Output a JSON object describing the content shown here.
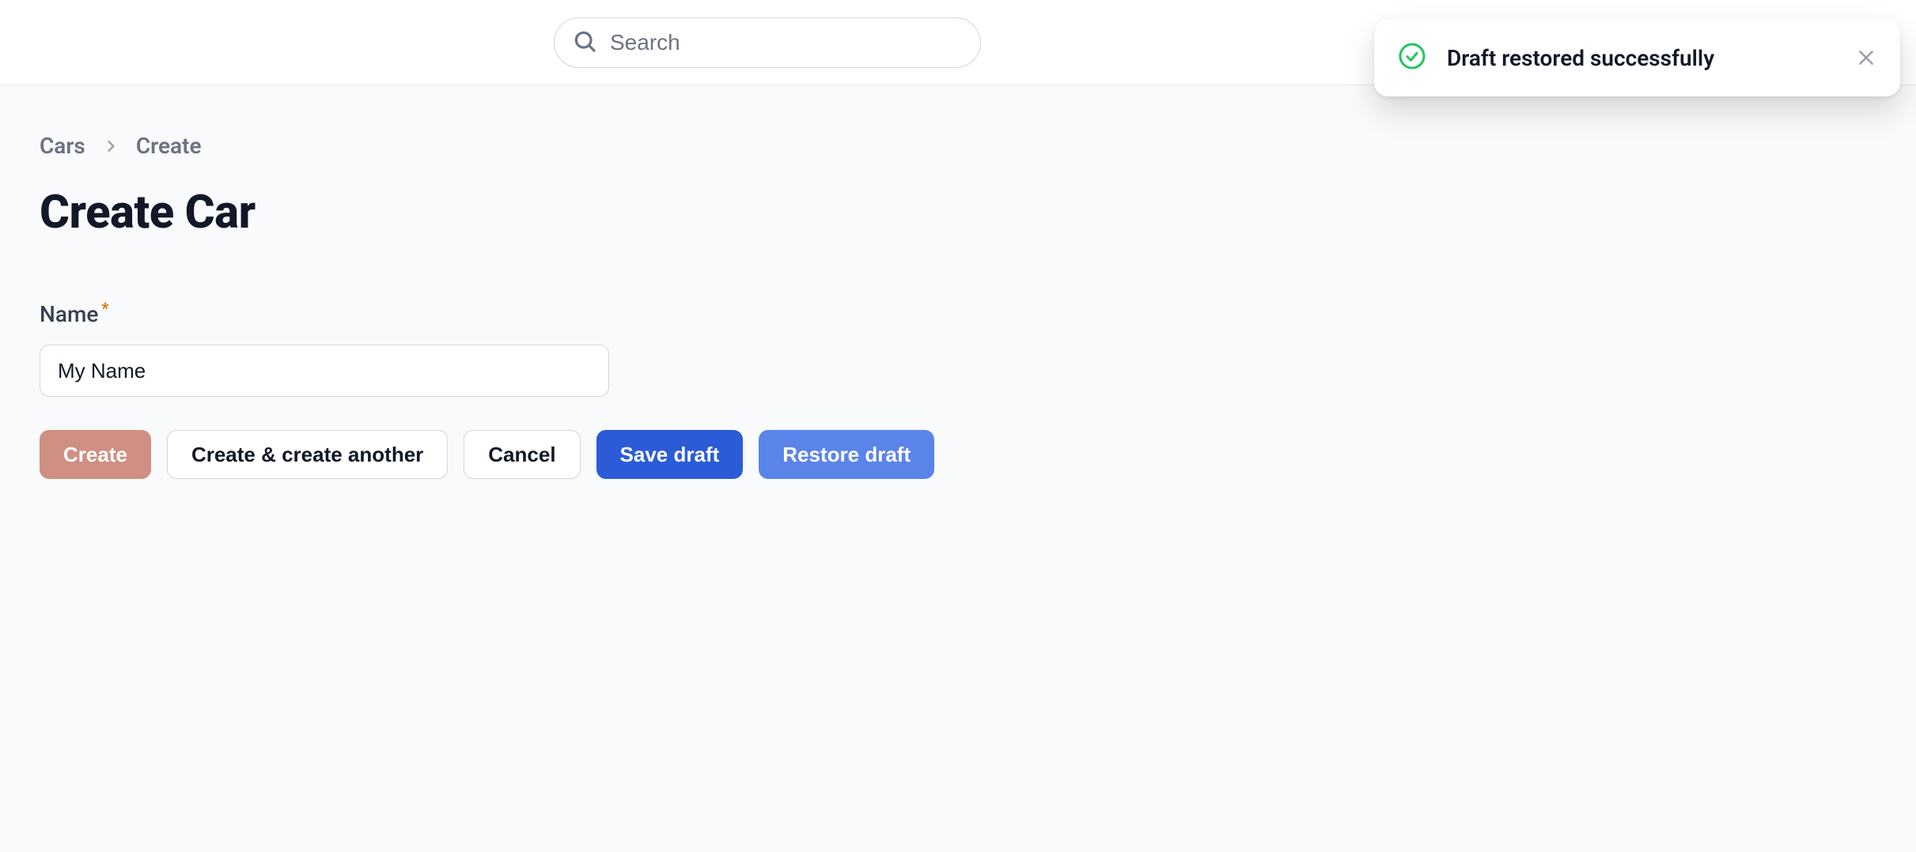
{
  "search": {
    "placeholder": "Search",
    "value": ""
  },
  "toast": {
    "message": "Draft restored successfully"
  },
  "breadcrumb": {
    "items": [
      {
        "label": "Cars"
      },
      {
        "label": "Create"
      }
    ]
  },
  "page": {
    "title": "Create Car"
  },
  "form": {
    "name": {
      "label": "Name",
      "required_marker": "*",
      "value": "My Name"
    }
  },
  "buttons": {
    "create": "Create",
    "create_another": "Create & create another",
    "cancel": "Cancel",
    "save_draft": "Save draft",
    "restore_draft": "Restore draft"
  },
  "colors": {
    "muted_button": "#cf8f82",
    "primary_dark": "#2b5bd7",
    "primary_light": "#5b84ea",
    "border": "#d1d5db",
    "page_bg": "#f9fafb",
    "success_icon": "#22c55e"
  }
}
